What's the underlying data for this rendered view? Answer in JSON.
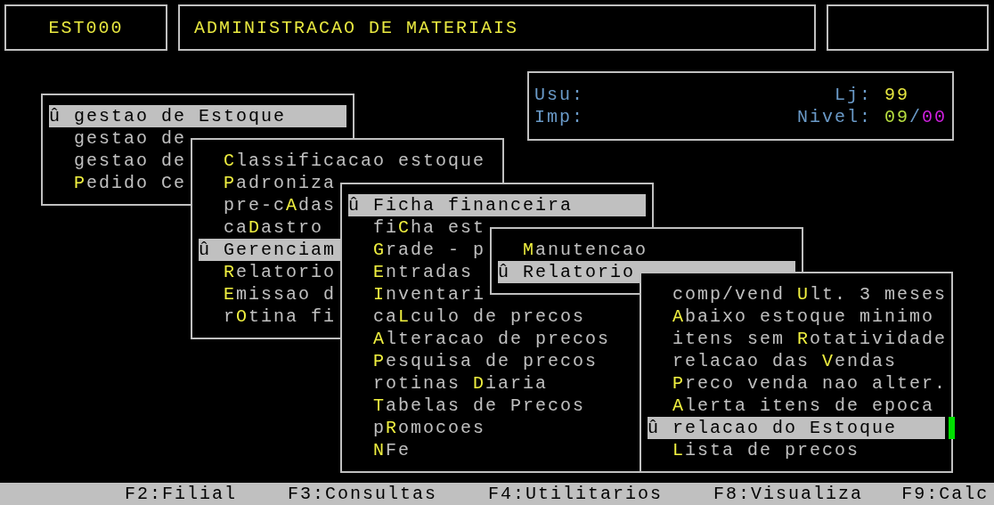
{
  "header": {
    "program_code": "EST000",
    "title": "ADMINISTRACAO DE MATERIAIS"
  },
  "info": {
    "user_label": "Usu:",
    "printer_label": "Imp:",
    "store_label": "Lj:",
    "store_value": "99",
    "level_label": "Nivel:",
    "level_value": "09",
    "level_separator": "/",
    "level_sub_value": "00"
  },
  "menus": [
    {
      "items": [
        {
          "selected": true,
          "marker": "û",
          "post": "gestao de Estoque"
        },
        {
          "selected": false,
          "post": "gestao de"
        },
        {
          "selected": false,
          "post": "gestao de"
        },
        {
          "selected": false,
          "key": "P",
          "post": "edido Ce"
        }
      ]
    },
    {
      "items": [
        {
          "selected": false,
          "key": "C",
          "post": "lassificacao estoque"
        },
        {
          "selected": false,
          "key": "P",
          "post": "adroniza"
        },
        {
          "selected": false,
          "pre": "pre-c",
          "key": "A",
          "post": "das"
        },
        {
          "selected": false,
          "pre": "ca",
          "key": "D",
          "post": "astro"
        },
        {
          "selected": true,
          "marker": "û",
          "post": "Gerenciam"
        },
        {
          "selected": false,
          "key": "R",
          "post": "elatorio"
        },
        {
          "selected": false,
          "key": "E",
          "post": "missao d"
        },
        {
          "selected": false,
          "pre": "r",
          "key": "O",
          "post": "tina fi"
        }
      ]
    },
    {
      "items": [
        {
          "selected": true,
          "marker": "û",
          "post": "Ficha financeira"
        },
        {
          "selected": false,
          "pre": "fi",
          "key": "C",
          "post": "ha est"
        },
        {
          "selected": false,
          "key": "G",
          "post": "rade - p"
        },
        {
          "selected": false,
          "key": "E",
          "post": "ntradas"
        },
        {
          "selected": false,
          "key": "I",
          "post": "nventari"
        },
        {
          "selected": false,
          "pre": "ca",
          "key": "L",
          "post": "culo de precos"
        },
        {
          "selected": false,
          "key": "A",
          "post": "lteracao de precos"
        },
        {
          "selected": false,
          "key": "P",
          "post": "esquisa de precos"
        },
        {
          "selected": false,
          "pre": "rotinas ",
          "key": "D",
          "post": "iaria"
        },
        {
          "selected": false,
          "key": "T",
          "post": "abelas de Precos"
        },
        {
          "selected": false,
          "pre": "p",
          "key": "R",
          "post": "omocoes"
        },
        {
          "selected": false,
          "key": "N",
          "post": "Fe"
        }
      ]
    },
    {
      "items": [
        {
          "selected": false,
          "key": "M",
          "post": "anutencao"
        },
        {
          "selected": true,
          "marker": "û",
          "post": "Relatorio"
        }
      ]
    },
    {
      "items": [
        {
          "selected": false,
          "pre": "comp/vend ",
          "key": "U",
          "post": "lt. 3 meses"
        },
        {
          "selected": false,
          "key": "A",
          "post": "baixo estoque minimo"
        },
        {
          "selected": false,
          "pre": "itens sem ",
          "key": "R",
          "post": "otatividade"
        },
        {
          "selected": false,
          "pre": "relacao das ",
          "key": "V",
          "post": "endas"
        },
        {
          "selected": false,
          "key": "P",
          "post": "reco venda nao alter."
        },
        {
          "selected": false,
          "key": "A",
          "post": "lerta itens de epoca"
        },
        {
          "selected": true,
          "marker": "û",
          "post": "relacao do Estoque",
          "cursor": true
        },
        {
          "selected": false,
          "key": "L",
          "post": "ista de precos"
        }
      ]
    }
  ],
  "function_keys": [
    "F2:Filial",
    "F3:Consultas",
    "F4:Utilitarios",
    "F8:Visualiza",
    "F9:Calc"
  ]
}
